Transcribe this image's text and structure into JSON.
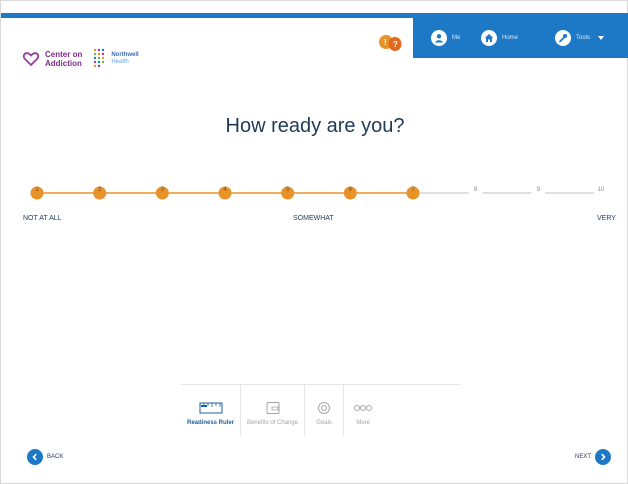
{
  "logo": {
    "line1": "Center on",
    "line2": "Addiction",
    "partner_line1": "Northwell",
    "partner_line2": "Health"
  },
  "nav": {
    "profile_label": "Me",
    "home_label": "Home",
    "tools_label": "Tools"
  },
  "page_title": "How ready are you?",
  "ruler": {
    "points": [
      "1",
      "2",
      "3",
      "4",
      "5",
      "6",
      "7",
      "8",
      "9",
      "10"
    ],
    "selected_value": 7,
    "active_color": "#e8922a",
    "inactive_color": "#d6d6d6",
    "low_label": "NOT AT ALL",
    "mid_label": "SOMEWHAT",
    "high_label": "VERY"
  },
  "tabs": [
    {
      "label": "Readiness Ruler",
      "icon": "ruler-icon"
    },
    {
      "label": "Benefits of Change",
      "icon": "wallet-icon"
    },
    {
      "label": "Goals",
      "icon": "target-icon"
    },
    {
      "label": "More",
      "icon": "more-icon"
    }
  ],
  "footer": {
    "back_label": "BACK",
    "next_label": "NEXT"
  },
  "colors": {
    "brand_blue": "#1d79c6",
    "accent_orange": "#e8922a",
    "logo_purple": "#7a2b86"
  }
}
